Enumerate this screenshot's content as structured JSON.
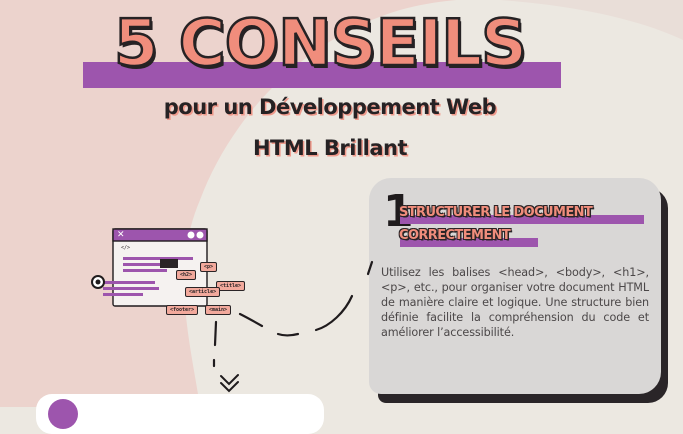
{
  "header": {
    "title": "5 CONSEILS",
    "subtitle_line1": "pour un Développement Web",
    "subtitle_line2": "HTML Brillant"
  },
  "tip1": {
    "number": "1",
    "heading_line1": "STRUCTURER LE DOCUMENT",
    "heading_line2": "CORRECTEMENT",
    "body": "Utilisez les balises <head>, <body>, <h1>, <p>, etc., pour organiser votre document HTML de manière claire et logique. Une structure bien définie facilite la compréhension du code et améliorer l’accessibilité."
  },
  "illustration": {
    "window_close": "✕",
    "window_tag": "</>",
    "tags": {
      "p": "<p>",
      "h2": "<h2>",
      "title": "<title>",
      "article": "<article>",
      "footer": "<footer>",
      "main": "<main>"
    }
  },
  "colors": {
    "background": "#ece8e1",
    "blob": "#ecd3cd",
    "coral": "#f08d7c",
    "purple": "#9d55ad",
    "dark": "#262224",
    "card": "#d9d7d6"
  }
}
